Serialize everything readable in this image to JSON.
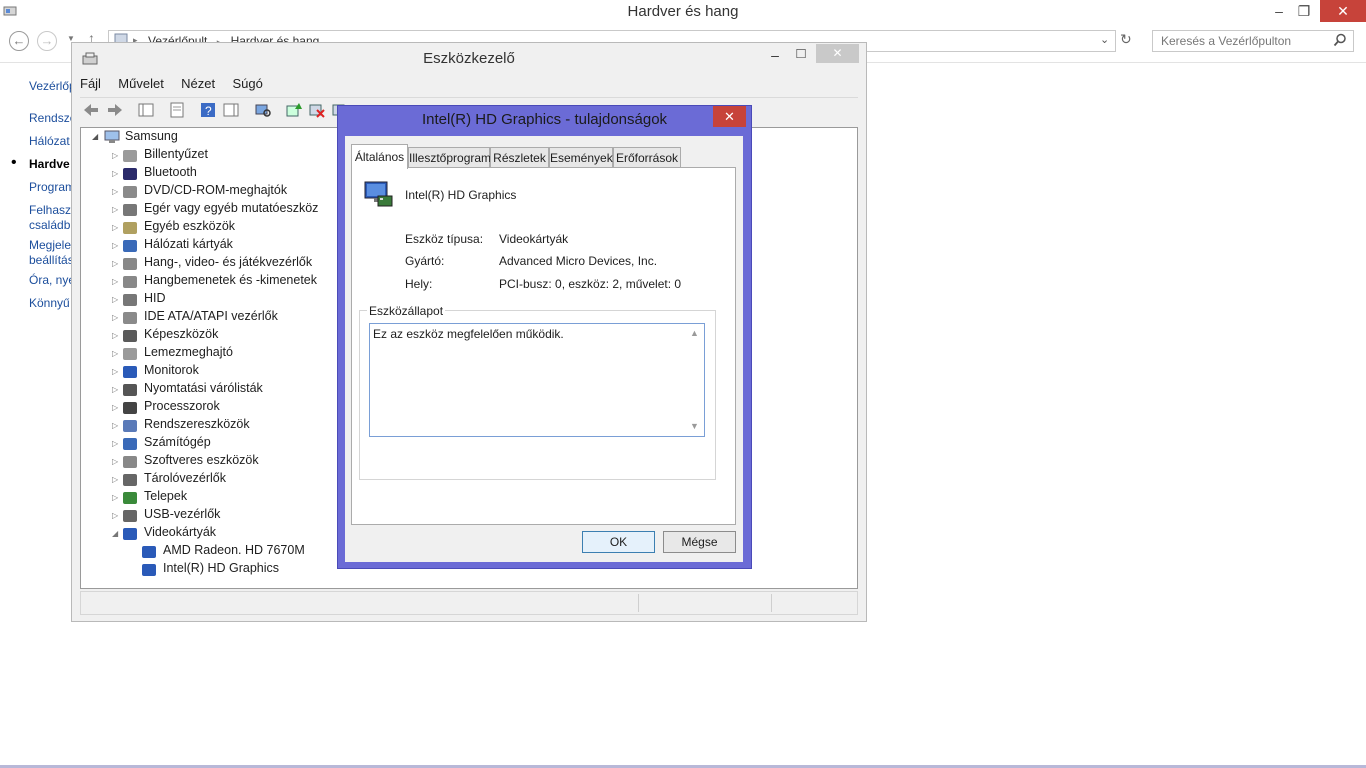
{
  "control_panel": {
    "title": "Hardver és hang",
    "nav": {
      "back": "←",
      "forward": "→",
      "up": "↑"
    },
    "breadcrumb": [
      "Vezérlőpult",
      "Hardver és hang"
    ],
    "breadcrumb_sep": "▸",
    "search_placeholder": "Keresés a Vezérlőpulton",
    "window_controls": {
      "minimize": "–",
      "restore": "❐",
      "close": "✕"
    },
    "sidebar": [
      {
        "label": "Vezérlőp"
      },
      {
        "label": "Rendsze"
      },
      {
        "label": "Hálózat"
      },
      {
        "label": "Hardve",
        "active": true
      },
      {
        "label": "Program"
      },
      {
        "label": "Felhaszn"
      },
      {
        "label": "családbi"
      },
      {
        "label": "Megjele"
      },
      {
        "label": "beállítás"
      },
      {
        "label": "Óra, nye"
      },
      {
        "label": "Könnyű"
      }
    ],
    "active_bullet": "•"
  },
  "device_manager": {
    "title": "Eszközkezelő",
    "window_controls": {
      "minimize": "–",
      "maximize": "□",
      "close": "✕"
    },
    "menu": [
      "Fájl",
      "Művelet",
      "Nézet",
      "Súgó"
    ],
    "tree_root": "Samsung",
    "tree": [
      "Billentyűzet",
      "Bluetooth",
      "DVD/CD-ROM-meghajtók",
      "Egér vagy egyéb mutatóeszköz",
      "Egyéb eszközök",
      "Hálózati kártyák",
      "Hang-, video- és játékvezérlők",
      "Hangbemenetek és -kimenetek",
      "HID",
      "IDE ATA/ATAPI vezérlők",
      "Képeszközök",
      "Lemezmeghajtó",
      "Monitorok",
      "Nyomtatási várólisták",
      "Processzorok",
      "Rendszereszközök",
      "Számítógép",
      "Szoftveres eszközök",
      "Tárolóvezérlők",
      "Telepek",
      "USB-vezérlők",
      "Videokártyák"
    ],
    "video_children": [
      "AMD Radeon. HD 7670M",
      "Intel(R) HD Graphics"
    ],
    "arrows": {
      "collapsed": "▷",
      "expanded": "◢"
    }
  },
  "dialog": {
    "title": "Intel(R) HD Graphics - tulajdonságok",
    "close": "✕",
    "tabs": [
      "Általános",
      "Illesztőprogram",
      "Részletek",
      "Események",
      "Erőforrások"
    ],
    "active_tab": "Általános",
    "device_name": "Intel(R) HD Graphics",
    "properties": [
      {
        "label": "Eszköz típusa:",
        "value": "Videokártyák"
      },
      {
        "label": "Gyártó:",
        "value": "Advanced Micro Devices, Inc."
      },
      {
        "label": "Hely:",
        "value": "PCI-busz: 0, eszköz: 2, művelet: 0"
      }
    ],
    "status_group_label": "Eszközállapot",
    "status_text": "Ez az eszköz megfelelően működik.",
    "scroll_up": "▲",
    "scroll_down": "▼",
    "ok": "OK",
    "cancel": "Mégse"
  }
}
